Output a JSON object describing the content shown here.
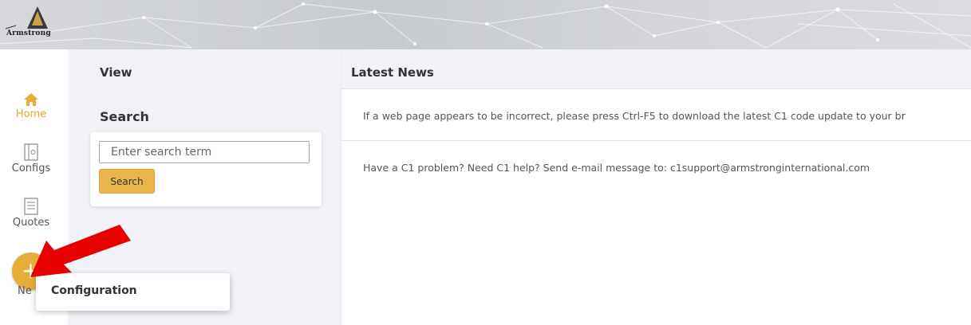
{
  "brand": {
    "logo_text": "Armstrong"
  },
  "rail": {
    "items": [
      {
        "label": "Home",
        "icon": "home-icon"
      },
      {
        "label": "Configs",
        "icon": "configs-icon"
      },
      {
        "label": "Quotes",
        "icon": "quotes-icon"
      }
    ],
    "new_label": "Ne",
    "fab_symbol": "+"
  },
  "view": {
    "title": "View",
    "search_title": "Search",
    "search_placeholder": "Enter search term",
    "search_button": "Search"
  },
  "news": {
    "title": "Latest News",
    "items": [
      "If a web page appears to be incorrect, please press Ctrl-F5 to download the latest C1 code update to your br",
      "Have a C1 problem? Need C1 help? Send e-mail message to: c1support@armstronginternational.com"
    ]
  },
  "popup": {
    "item": "Configuration"
  },
  "colors": {
    "accent": "#e5ad3a",
    "panel": "#f0f2f8",
    "annotation_arrow": "#e60000"
  }
}
